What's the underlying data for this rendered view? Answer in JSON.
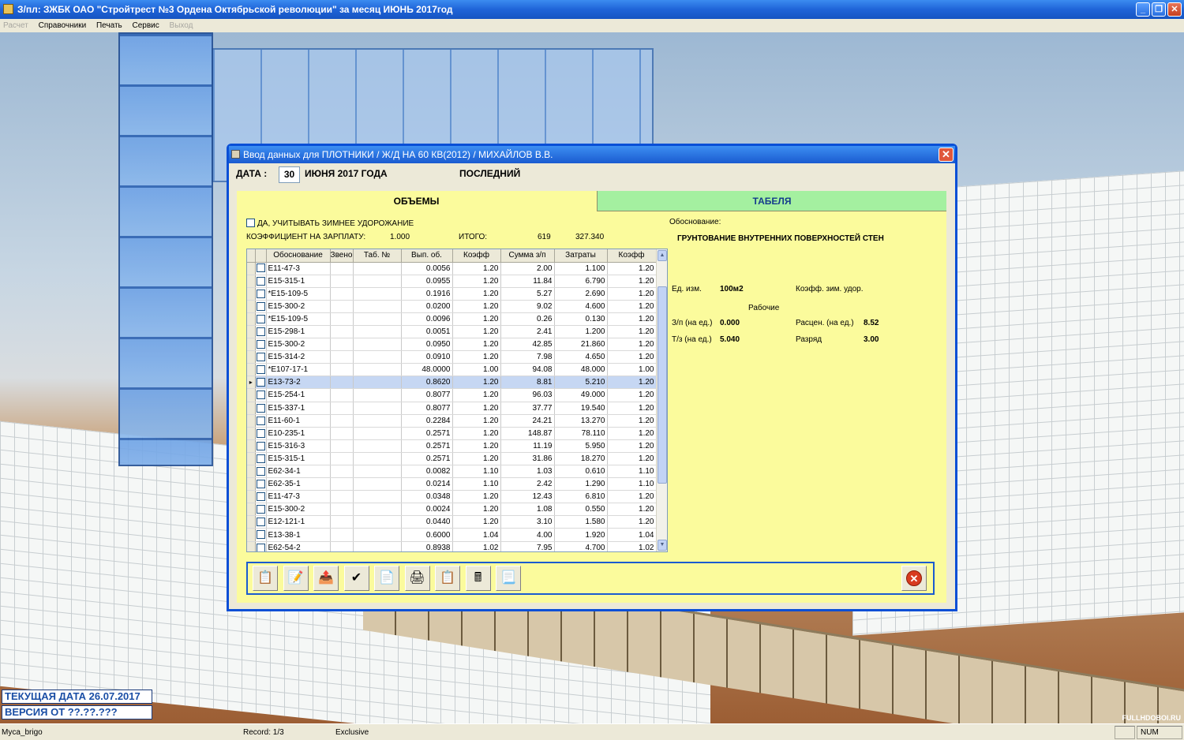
{
  "window": {
    "title": "З/пл: ЗЖБК ОАО \"Стройтрест №3 Ордена Октябрьской революции\" за месяц ИЮНЬ 2017год"
  },
  "menu": [
    {
      "label": "Расчет",
      "enabled": false
    },
    {
      "label": "Справочники",
      "enabled": true
    },
    {
      "label": "Печать",
      "enabled": true
    },
    {
      "label": "Сервис",
      "enabled": true
    },
    {
      "label": "Выход",
      "enabled": false
    }
  ],
  "dialog": {
    "title": "Ввод данных для ПЛОТНИКИ / Ж/Д НА 60 КВ(2012) / МИХАЙЛОВ В.В.",
    "date_label": "ДАТА :",
    "day": "30",
    "month_text": "ИЮНЯ 2017 ГОДА",
    "last_label": "ПОСЛЕДНИЙ",
    "tabs": {
      "volumes": "ОБЪЕМЫ",
      "timesheets": "ТАБЕЛЯ"
    },
    "winter_label": "ДА, УЧИТЫВАТЬ ЗИМНЕЕ УДОРОЖАНИЕ",
    "coef_label": "КОЭФФИЦИЕНТ НА ЗАРПЛАТУ:",
    "coef_value": "1.000",
    "total_label": "ИТОГО:",
    "total_sum": "619",
    "total_cost": "327.340",
    "basis_label": "Обоснование:",
    "basis_value": "ГРУНТОВАНИЕ ВНУТРЕННИХ ПОВЕРХНОСТЕЙ СТЕН",
    "unit_label": "Ед. изм.",
    "unit_value": "100м2",
    "winter_coef_label": "Коэфф. зим. удор.",
    "workers_label": "Рабочие",
    "pay_label": "З/п (на ед.)",
    "pay_value": "0.000",
    "rate_label": "Расцен. (на ед.)",
    "rate_value": "8.52",
    "labor_label": "Т/з (на ед.)",
    "labor_value": "5.040",
    "grade_label": "Разряд",
    "grade_value": "3.00"
  },
  "grid": {
    "columns": [
      "Обоснование",
      "Звено",
      "Таб. №",
      "Вып. об.",
      "Коэфф",
      "Сумма з/п",
      "Затраты",
      "Коэфф"
    ],
    "rows": [
      [
        "E11-47-3",
        "",
        "",
        "0.0056",
        "1.20",
        "2.00",
        "1.100",
        "1.20"
      ],
      [
        "E15-315-1",
        "",
        "",
        "0.0955",
        "1.20",
        "11.84",
        "6.790",
        "1.20"
      ],
      [
        "*E15-109-5",
        "",
        "",
        "0.1916",
        "1.20",
        "5.27",
        "2.690",
        "1.20"
      ],
      [
        "E15-300-2",
        "",
        "",
        "0.0200",
        "1.20",
        "9.02",
        "4.600",
        "1.20"
      ],
      [
        "*E15-109-5",
        "",
        "",
        "0.0096",
        "1.20",
        "0.26",
        "0.130",
        "1.20"
      ],
      [
        "E15-298-1",
        "",
        "",
        "0.0051",
        "1.20",
        "2.41",
        "1.200",
        "1.20"
      ],
      [
        "E15-300-2",
        "",
        "",
        "0.0950",
        "1.20",
        "42.85",
        "21.860",
        "1.20"
      ],
      [
        "E15-314-2",
        "",
        "",
        "0.0910",
        "1.20",
        "7.98",
        "4.650",
        "1.20"
      ],
      [
        "*E107-17-1",
        "",
        "",
        "48.0000",
        "1.00",
        "94.08",
        "48.000",
        "1.00"
      ],
      [
        "E13-73-2",
        "",
        "",
        "0.8620",
        "1.20",
        "8.81",
        "5.210",
        "1.20"
      ],
      [
        "E15-254-1",
        "",
        "",
        "0.8077",
        "1.20",
        "96.03",
        "49.000",
        "1.20"
      ],
      [
        "E15-337-1",
        "",
        "",
        "0.8077",
        "1.20",
        "37.77",
        "19.540",
        "1.20"
      ],
      [
        "E11-60-1",
        "",
        "",
        "0.2284",
        "1.20",
        "24.21",
        "13.270",
        "1.20"
      ],
      [
        "E10-235-1",
        "",
        "",
        "0.2571",
        "1.20",
        "148.87",
        "78.110",
        "1.20"
      ],
      [
        "E15-316-3",
        "",
        "",
        "0.2571",
        "1.20",
        "11.19",
        "5.950",
        "1.20"
      ],
      [
        "E15-315-1",
        "",
        "",
        "0.2571",
        "1.20",
        "31.86",
        "18.270",
        "1.20"
      ],
      [
        "E62-34-1",
        "",
        "",
        "0.0082",
        "1.10",
        "1.03",
        "0.610",
        "1.10"
      ],
      [
        "E62-35-1",
        "",
        "",
        "0.0214",
        "1.10",
        "2.42",
        "1.290",
        "1.10"
      ],
      [
        "E11-47-3",
        "",
        "",
        "0.0348",
        "1.20",
        "12.43",
        "6.810",
        "1.20"
      ],
      [
        "E15-300-2",
        "",
        "",
        "0.0024",
        "1.20",
        "1.08",
        "0.550",
        "1.20"
      ],
      [
        "E12-121-1",
        "",
        "",
        "0.0440",
        "1.20",
        "3.10",
        "1.580",
        "1.20"
      ],
      [
        "E13-38-1",
        "",
        "",
        "0.6000",
        "1.04",
        "4.00",
        "1.920",
        "1.04"
      ],
      [
        "E62-54-2",
        "",
        "",
        "0.8938",
        "1.02",
        "7.95",
        "4.700",
        "1.02"
      ]
    ],
    "selected_row": 9
  },
  "toolbar": {
    "buttons": [
      {
        "name": "add-record-icon",
        "glyph": "📋",
        "enabled": true
      },
      {
        "name": "edit-record-icon",
        "glyph": "📝",
        "enabled": true
      },
      {
        "name": "delete-record-icon",
        "glyph": "📤",
        "enabled": true
      },
      {
        "name": "confirm-check-icon",
        "glyph": "✔",
        "enabled": true
      },
      {
        "name": "copy-record-icon",
        "glyph": "📄",
        "enabled": true
      },
      {
        "name": "print-icon",
        "glyph": "🖨",
        "enabled": true
      },
      {
        "name": "paste-icon",
        "glyph": "📋",
        "enabled": false
      },
      {
        "name": "calculator-icon",
        "glyph": "🖩",
        "enabled": true
      },
      {
        "name": "new-document-icon",
        "glyph": "📃",
        "enabled": true
      }
    ],
    "exit_glyph": "✕"
  },
  "info_boxes": {
    "current_date": "ТЕКУЩАЯ ДАТА 26.07.2017",
    "version": "ВЕРСИЯ ОТ       ??.??.???"
  },
  "statusbar": {
    "user": "Myca_brigo",
    "record": "Record: 1/3",
    "mode": "Exclusive",
    "num": "NUM"
  },
  "watermark": "FULLHDOBOI.RU"
}
